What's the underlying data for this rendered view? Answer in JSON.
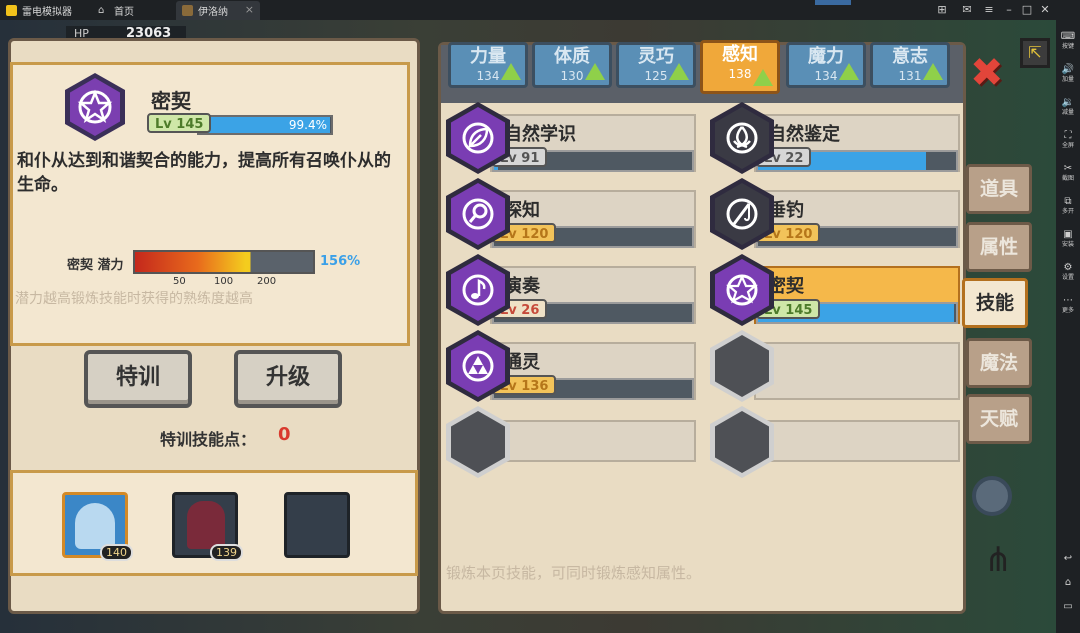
{
  "emulator": {
    "app_name": "雷电模拟器",
    "tabs": [
      {
        "label": "首页"
      },
      {
        "label": "伊洛纳"
      }
    ],
    "sidebar": [
      "按键",
      "加量",
      "减量",
      "全屏",
      "截图",
      "多开",
      "安装",
      "设置",
      "更多"
    ]
  },
  "game": {
    "hp_label": "HP",
    "hp_value": "23063",
    "skill_detail": {
      "name": "密契",
      "level": "Lv 145",
      "progress_text": "99.4%",
      "progress": 0.994,
      "description": "和仆从达到和谐契合的能力，提高所有召唤仆从的生命。",
      "potential_label": "密契 潜力",
      "potential_value": "156%",
      "potential_ticks": [
        "50",
        "100",
        "200"
      ],
      "hint": "潜力越高锻炼技能时获得的熟练度越高"
    },
    "buttons": {
      "train": "特训",
      "upgrade": "升级"
    },
    "train_points_label": "特训技能点：",
    "train_points_value": "0",
    "party": [
      {
        "level": "140"
      },
      {
        "level": "139"
      }
    ],
    "stat_tabs": [
      {
        "name": "力量",
        "value": "134"
      },
      {
        "name": "体质",
        "value": "130"
      },
      {
        "name": "灵巧",
        "value": "125"
      },
      {
        "name": "感知",
        "value": "138"
      },
      {
        "name": "魔力",
        "value": "134"
      },
      {
        "name": "意志",
        "value": "131"
      }
    ],
    "skills": [
      {
        "name": "自然学识",
        "level": "Lv 91",
        "progress": 0.02
      },
      {
        "name": "自然鉴定",
        "level": "Lv 22",
        "progress": 0.85
      },
      {
        "name": "探知",
        "level": "Lv 120",
        "progress": 0.0
      },
      {
        "name": "垂钓",
        "level": "Lv 120",
        "progress": 0.0
      },
      {
        "name": "演奏",
        "level": "Lv 26",
        "progress": 0.0
      },
      {
        "name": "密契",
        "level": "Lv 145",
        "progress": 0.99
      },
      {
        "name": "通灵",
        "level": "Lv 136",
        "progress": 0.0
      }
    ],
    "side_tabs": [
      "道具",
      "属性",
      "技能",
      "魔法",
      "天赋"
    ],
    "footer_hint": "锻炼本页技能，可同时锻炼感知属性。"
  }
}
